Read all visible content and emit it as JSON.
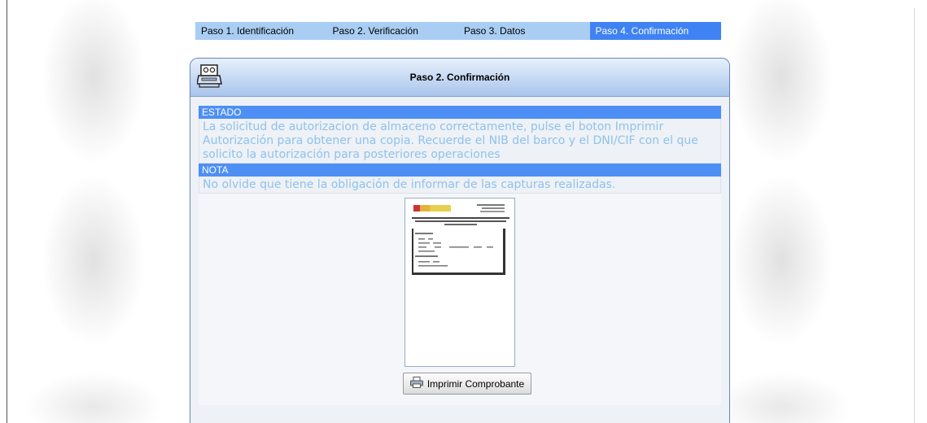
{
  "steps": [
    {
      "label": "Paso 1. Identificación",
      "active": false
    },
    {
      "label": "Paso 2. Verificación",
      "active": false
    },
    {
      "label": "Paso 3. Datos",
      "active": false
    },
    {
      "label": "Paso 4. Confirmación",
      "active": true
    }
  ],
  "panel": {
    "title": "Paso 2. Confirmación",
    "icon": "printer-icon"
  },
  "estado": {
    "label": "ESTADO",
    "text": "La solicitud de autorizacion de almaceno correctamente, pulse el boton Imprimir Autorización para obtener una copia. Recuerde el NIB del barco y el DNI/CIF con el que solicito la autorización para posteriores operaciones"
  },
  "nota": {
    "label": "NOTA",
    "text": "No olvide que tiene la obligación de informar de las capturas realizadas."
  },
  "document_preview": {
    "icon": "document-thumbnail-icon"
  },
  "print_button": {
    "label": "Imprimir Comprobante",
    "icon": "printer-icon"
  },
  "colors": {
    "step_bar": "#a9cdf3",
    "step_active": "#3f82f3",
    "section_label_bg": "#4d8ff5",
    "section_text": "#8fc2ec",
    "panel_border": "#6686b9"
  }
}
